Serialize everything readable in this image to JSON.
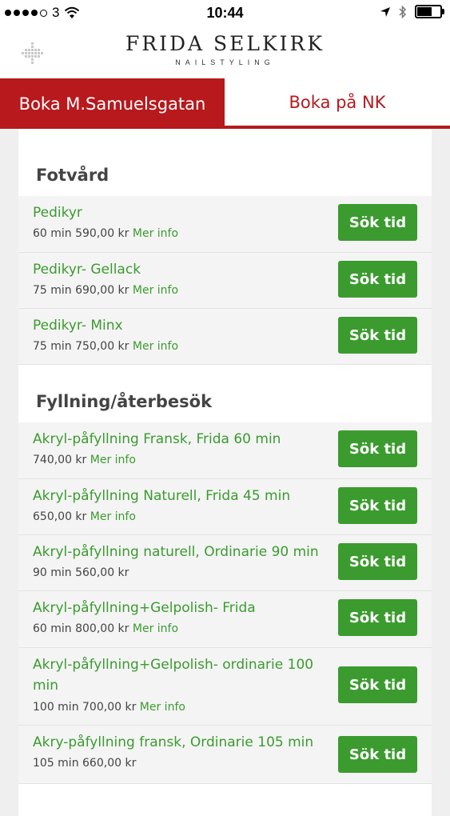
{
  "status_bar": {
    "carrier": "3",
    "time": "10:44"
  },
  "header": {
    "brand_name": "FRIDA SELKIRK",
    "brand_sub": "NAILSTYLING"
  },
  "tabs": [
    {
      "label": "Boka M.Samuelsgatan",
      "active": true
    },
    {
      "label": "Boka på NK",
      "active": false
    }
  ],
  "colors": {
    "accent_red": "#b7191d",
    "green": "#3b9b2f"
  },
  "categories": [
    {
      "title": "Fotvård",
      "services": [
        {
          "name": "Pedikyr",
          "meta": "60 min 590,00 kr",
          "more": "Mer info",
          "button": "Sök tid"
        },
        {
          "name": "Pedikyr- Gellack",
          "meta": "75 min 690,00 kr",
          "more": "Mer info",
          "button": "Sök tid"
        },
        {
          "name": "Pedikyr- Minx",
          "meta": "75 min 750,00 kr",
          "more": "Mer info",
          "button": "Sök tid"
        }
      ]
    },
    {
      "title": "Fyllning/återbesök",
      "services": [
        {
          "name": "Akryl-påfyllning Fransk, Frida 60 min",
          "meta": "740,00 kr",
          "more": "Mer info",
          "button": "Sök tid"
        },
        {
          "name": "Akryl-påfyllning Naturell, Frida 45 min",
          "meta": "650,00 kr",
          "more": "Mer info",
          "button": "Sök tid"
        },
        {
          "name": "Akryl-påfyllning naturell, Ordinarie 90 min",
          "meta": "90 min 560,00 kr",
          "more": "",
          "button": "Sök tid"
        },
        {
          "name": "Akryl-påfyllning+Gelpolish- Frida",
          "meta": "60 min 800,00 kr",
          "more": "Mer info",
          "button": "Sök tid"
        },
        {
          "name": "Akryl-påfyllning+Gelpolish- ordinarie 100 min",
          "meta": "100 min 700,00 kr",
          "more": "Mer info",
          "button": "Sök tid"
        },
        {
          "name": "Akry-påfyllning fransk, Ordinarie 105 min",
          "meta": "105 min 660,00 kr",
          "more": "",
          "button": "Sök tid"
        }
      ]
    }
  ]
}
